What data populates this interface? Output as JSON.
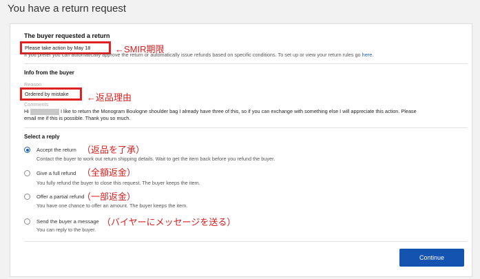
{
  "page": {
    "title": "You have a return request"
  },
  "request": {
    "heading": "The buyer requested a return",
    "deadline": "Please take action by May 18",
    "rules_text": "If you prefer you can automatically approve the return or automatically issue refunds based on specific conditions. To set up or view your return rules go",
    "rules_link": "here",
    "rules_end": "."
  },
  "buyer_info": {
    "heading": "Info from the buyer",
    "reason_label": "Reason",
    "reason_value": "Ordered by mistake",
    "comments_label": "Comments",
    "comment_prefix": "Hi",
    "comment_line1": "I like to return the Monogram Boulogne shoulder bag I already have three of this, so if you can exchange with something else I will appreciate this action. Please",
    "comment_line2": "email me if this is possible. Thank you so much."
  },
  "reply": {
    "heading": "Select a reply",
    "options": [
      {
        "label": "Accept the return",
        "desc": "Contact the buyer to work out return shipping details. Wait to get the item back before you refund the buyer.",
        "annotation": "（返品を了承）",
        "selected": true
      },
      {
        "label": "Give a full refund",
        "desc": "You fully refund the buyer to close this request. The buyer keeps the item.",
        "annotation": "（全額返金）",
        "selected": false
      },
      {
        "label": "Offer a partial refund",
        "desc": "You have one chance to offer an amount. The buyer keeps the item.",
        "annotation": "（一部返金）",
        "selected": false
      },
      {
        "label": "Send the buyer a message",
        "desc": "You can reply to the buyer.",
        "annotation": "（バイヤーにメッセージを送る）",
        "selected": false
      }
    ]
  },
  "annotations": {
    "deadline": "←SMIR期限",
    "reason": "←返品理由"
  },
  "actions": {
    "continue": "Continue"
  },
  "colors": {
    "accent": "#1553b0",
    "annotation": "#d81e1e",
    "link": "#1a5fb4"
  }
}
